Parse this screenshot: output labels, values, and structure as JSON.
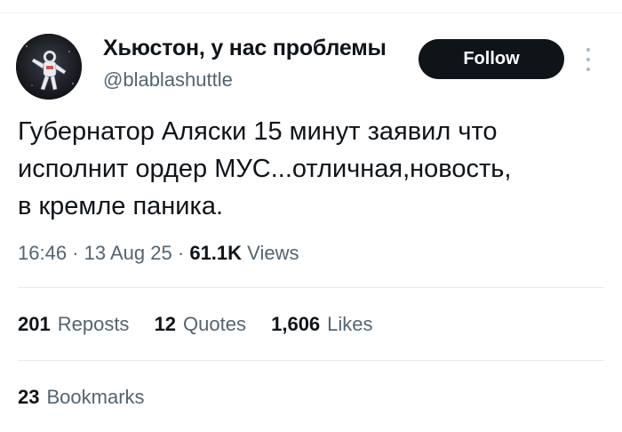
{
  "author": {
    "display_name": "Хьюстон, у нас проблемы",
    "handle": "@blablashuttle"
  },
  "actions": {
    "follow_label": "Follow"
  },
  "tweet": {
    "lines": [
      "Губернатор Аляски 15 минут заявил что",
      "исполнит ордер МУС...отличная,новость,",
      "в кремле паника."
    ]
  },
  "meta": {
    "time": "16:46",
    "separator": "·",
    "date": "13 Aug 25",
    "views_count": "61.1K",
    "views_label": "Views"
  },
  "stats": {
    "reposts_count": "201",
    "reposts_label": "Reposts",
    "quotes_count": "12",
    "quotes_label": "Quotes",
    "likes_count": "1,606",
    "likes_label": "Likes",
    "bookmarks_count": "23",
    "bookmarks_label": "Bookmarks"
  },
  "colors": {
    "text_primary": "#0f1419",
    "text_secondary": "#536471",
    "button_bg": "#0f1419",
    "divider": "#e6ecf0"
  },
  "icons": {
    "avatar": "astronaut-avatar",
    "more": "more-vertical-icon"
  }
}
